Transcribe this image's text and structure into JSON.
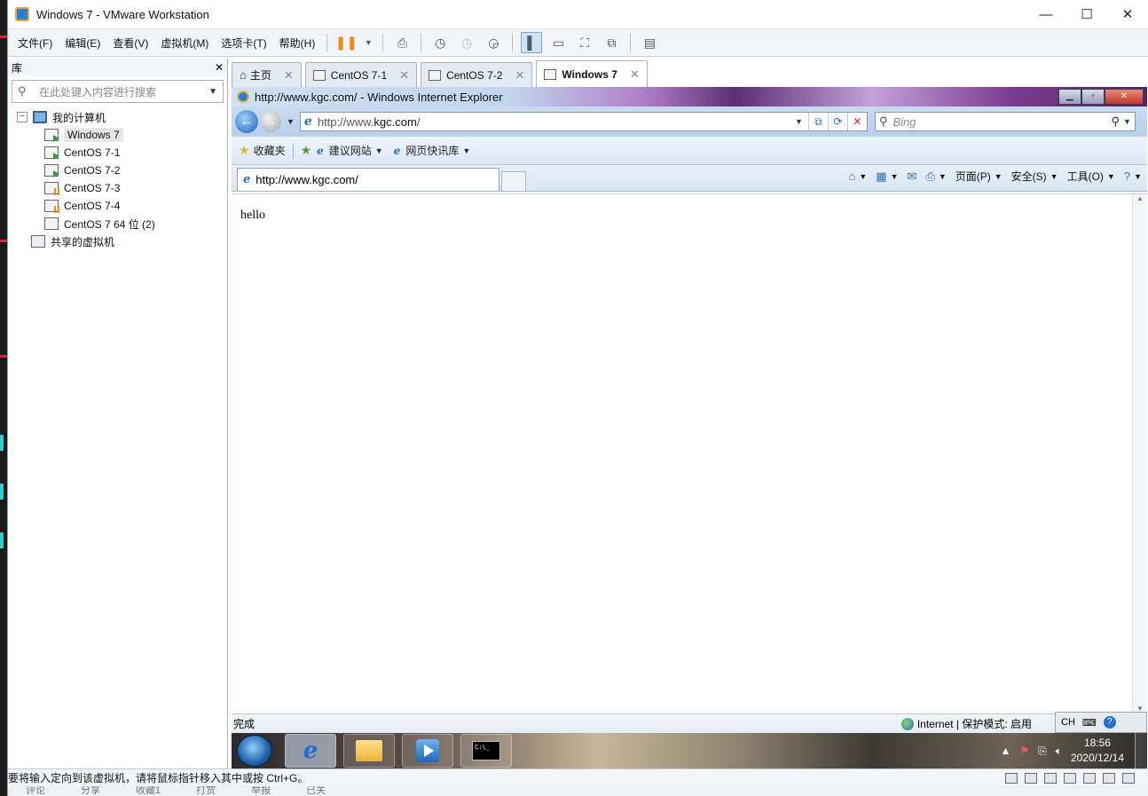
{
  "window": {
    "title": "Windows 7  - VMware Workstation",
    "controls": [
      "—",
      "☐",
      "✕"
    ]
  },
  "menu": [
    "文件(F)",
    "编辑(E)",
    "查看(V)",
    "虚拟机(M)",
    "选项卡(T)",
    "帮助(H)"
  ],
  "library": {
    "title": "库",
    "close": "✕",
    "search_placeholder": "在此处键入内容进行搜索",
    "root": "我的计算机",
    "vms": [
      "Windows 7",
      "CentOS 7-1",
      "CentOS 7-2",
      "CentOS 7-3",
      "CentOS 7-4",
      "CentOS 7 64 位 (2)"
    ],
    "shared": "共享的虚拟机"
  },
  "tabs": [
    {
      "label": "主页",
      "icon": "home-icon"
    },
    {
      "label": "CentOS 7-1",
      "icon": "vm-icon"
    },
    {
      "label": "CentOS 7-2",
      "icon": "vm-icon"
    },
    {
      "label": "Windows 7",
      "icon": "vm-icon",
      "active": true
    }
  ],
  "ie": {
    "title": "http://www.kgc.com/ - Windows Internet Explorer",
    "address_prefix": "http://www.",
    "address_domain": "kgc.com",
    "address_suffix": "/",
    "search_placeholder": "Bing",
    "favorites_label": "收藏夹",
    "suggested_sites": "建议网站",
    "web_slice": "网页快讯库",
    "tab_title": "http://www.kgc.com/",
    "page_menu": "页面(P)",
    "safety_menu": "安全(S)",
    "tools_menu": "工具(O)",
    "page_body": "hello",
    "status_left": "完成",
    "status_zone": "Internet | 保护模式: 启用"
  },
  "guest_taskbar": {
    "lang": "CH",
    "time": "18:56",
    "date": "2020/12/14"
  },
  "vm_statusbar": "要将输入定向到该虚拟机，请将鼠标指针移入其中或按 Ctrl+G。",
  "bottom_strip": [
    "评论",
    "分享",
    "收藏1",
    "打赏",
    "举报",
    "已关"
  ],
  "colors": {
    "accent": "#1e6fd0",
    "pause": "#e88c1a",
    "vm_running": "#2e9b3e"
  }
}
